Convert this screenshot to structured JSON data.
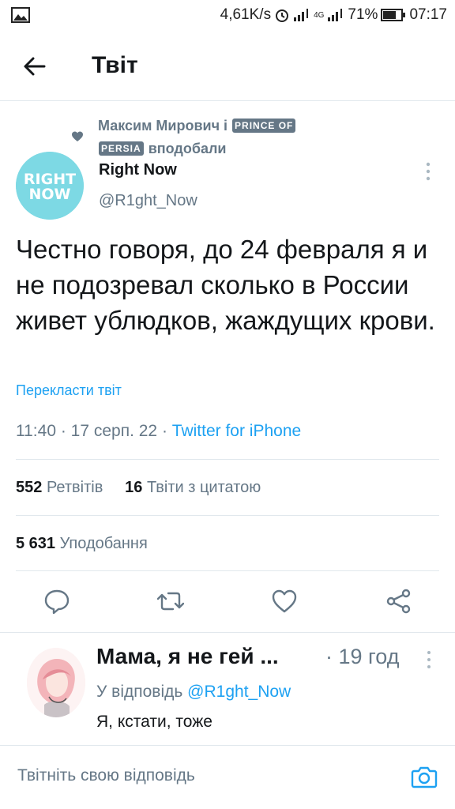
{
  "status_bar": {
    "speed": "4,61K/s",
    "network": "4G",
    "battery": "71%",
    "time": "07:17"
  },
  "header": {
    "title": "Твіт"
  },
  "liked_by": {
    "name1": "Максим Мирович і",
    "name2_part1": "PRINCE OF",
    "name2_part2": "PERSIA",
    "suffix": "вподобали"
  },
  "author": {
    "avatar_text_line1": "RIGHT",
    "avatar_text_line2": "NOW",
    "name": "Right Now",
    "handle": "@R1ght_Now"
  },
  "tweet": {
    "text": "Честно говоря, до 24 февраля я и не подозревал сколько в России живет ублюдков, жаждущих крови.",
    "translate": "Перекласти твіт",
    "time": "11:40 · 17 серп. 22 · ",
    "source": "Twitter for iPhone"
  },
  "stats": {
    "retweets_count": "552",
    "retweets_label": "Ретвітів",
    "quotes_count": "16",
    "quotes_label": "Твіти з цитатою",
    "likes_count": "5 631",
    "likes_label": "Уподобання"
  },
  "icons": {
    "reply": "comment-icon",
    "retweet": "retweet-icon",
    "like": "heart-icon",
    "share": "share-icon"
  },
  "reply": {
    "name": "Мама, я не гей ...",
    "time": "· 19 год",
    "reply_to_label": "У відповідь",
    "reply_to_handle": "@R1ght_Now",
    "text": "Я, кстати, тоже"
  },
  "compose": {
    "placeholder": "Твітніть свою відповідь"
  },
  "colors": {
    "accent": "#1da1f2",
    "secondary_text": "#657786",
    "primary_text": "#14171a",
    "avatar_bg": "#7dd9e4"
  }
}
